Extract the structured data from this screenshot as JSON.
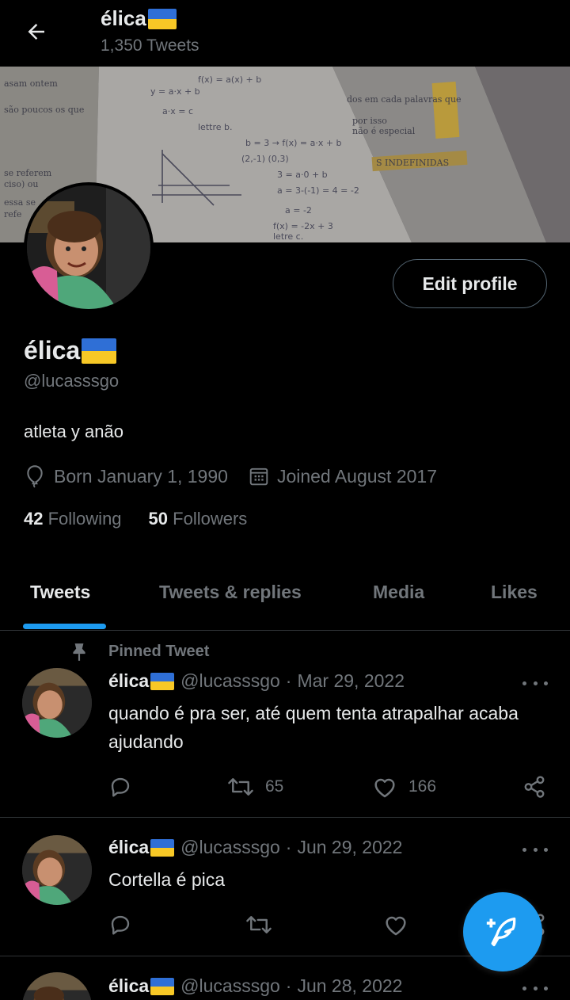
{
  "header": {
    "display_name": "élica",
    "tweet_count": "1,350 Tweets"
  },
  "profile": {
    "display_name": "élica",
    "handle": "@lucasssgo",
    "bio": "atleta y anão",
    "birthday": "Born January 1, 1990",
    "joined": "Joined August 2017",
    "following_count": "42",
    "following_label": "Following",
    "followers_count": "50",
    "followers_label": "Followers",
    "edit_button": "Edit profile"
  },
  "tabs": [
    {
      "label": "Tweets",
      "active": true
    },
    {
      "label": "Tweets & replies",
      "active": false
    },
    {
      "label": "Media",
      "active": false
    },
    {
      "label": "Likes",
      "active": false
    }
  ],
  "pinned_label": "Pinned Tweet",
  "tweets": [
    {
      "name": "élica",
      "handle": "@lucasssgo",
      "date": "Mar 29, 2022",
      "text": "quando é pra ser, até quem tenta atrapalhar acaba ajudando",
      "retweets": "65",
      "likes": "166"
    },
    {
      "name": "élica",
      "handle": "@lucasssgo",
      "date": "Jun 29, 2022",
      "text": "Cortella é pica",
      "retweets": "",
      "likes": ""
    },
    {
      "name": "élica",
      "handle": "@lucasssgo",
      "date": "Jun 28, 2022",
      "text": "",
      "retweets": "",
      "likes": ""
    }
  ],
  "colors": {
    "accent": "#1d9bf0",
    "background": "#000000",
    "text_primary": "#e7e9ea",
    "text_secondary": "#71767b",
    "divider": "#2f3336",
    "flag_blue": "#2f6fd6",
    "flag_yellow": "#f7c826"
  },
  "icons": {
    "back": "arrow-left-icon",
    "birthday": "balloon-icon",
    "joined": "calendar-icon",
    "pinned": "pin-icon",
    "reply": "reply-icon",
    "retweet": "retweet-icon",
    "like": "heart-icon",
    "share": "share-icon",
    "more": "more-icon",
    "compose": "compose-feather-icon"
  }
}
